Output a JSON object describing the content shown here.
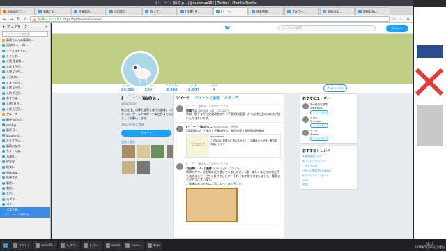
{
  "window": {
    "title": "(・｀ー´・)ぬのぉ…(@nunonuo15) | Twitter - Mozilla Firefox"
  },
  "tabs": [
    {
      "label": "Blogger: こ…",
      "type": "blogger"
    },
    {
      "label": "長崎にゃ…",
      "type": "twitter"
    },
    {
      "label": "佐賀県の…",
      "type": "twitter"
    },
    {
      "label": "山口県で…",
      "type": "twitter"
    },
    {
      "label": "(伝えて…",
      "type": "twitter"
    },
    {
      "label": "(自撮りを…",
      "type": "twitter"
    },
    {
      "label": "(・｀ー…",
      "type": "twitter",
      "active": true
    },
    {
      "label": "囲碁戦略…",
      "type": "twitter"
    },
    {
      "label": "フォロー…",
      "type": "twitter"
    },
    {
      "label": "WebLOG…",
      "type": "other"
    },
    {
      "label": "WebLOG…",
      "type": "other"
    }
  ],
  "navbar": {
    "url_org": "Twitter, Inc. (US)",
    "url": "https://twitter.com/nunonuo"
  },
  "sidebar": {
    "title": "ブックマーク",
    "search_placeholder": "ブックマークを検索",
    "items": [
      {
        "label": "藤崎ちゃんの藤崎の…",
        "type": "folder"
      },
      {
        "label": "速報(ニュース)…",
        "type": "tw"
      },
      {
        "label": "ノースライトの…",
        "type": "tw"
      },
      {
        "label": "こうたの…",
        "type": "tw"
      },
      {
        "label": "入院 患者数…",
        "type": "tw"
      },
      {
        "label": "入院 1日目…",
        "type": "tw"
      },
      {
        "label": "入院 2日目…",
        "type": "tw"
      },
      {
        "label": "十日町の…",
        "type": "tw"
      },
      {
        "label": "くまちゃん…",
        "type": "tw"
      },
      {
        "label": "入院 3日目…",
        "type": "tw"
      },
      {
        "label": "入院 4日目…",
        "type": "tw"
      },
      {
        "label": "おきつ@…",
        "type": "tw"
      },
      {
        "label": "入院4日目…",
        "type": "tw"
      },
      {
        "label": "入院 5日目…",
        "type": "tw"
      },
      {
        "label": "グループ",
        "type": "folder"
      },
      {
        "label": "藤巻 @fnm…",
        "type": "tw"
      },
      {
        "label": "mm8@…",
        "type": "tw"
      },
      {
        "label": "藤原-3.…",
        "type": "tw"
      },
      {
        "label": "kazufumi…",
        "type": "tw"
      },
      {
        "label": "ダイクプレ…",
        "type": "tw"
      },
      {
        "label": "藤崎のなぎ…",
        "type": "tw"
      },
      {
        "label": "ちりーん@…",
        "type": "tw"
      },
      {
        "label": "TORU…",
        "type": "tw"
      },
      {
        "label": "鈴谷@…",
        "type": "tw"
      },
      {
        "label": "結束(…",
        "type": "tw"
      },
      {
        "label": "Shibata…",
        "type": "tw"
      },
      {
        "label": "佐藤さま…",
        "type": "tw"
      },
      {
        "label": "藤原…",
        "type": "tw"
      },
      {
        "label": "兼松…",
        "type": "tw"
      },
      {
        "label": "大戸…",
        "type": "tw"
      },
      {
        "label": "コダマ…",
        "type": "tw"
      },
      {
        "label": "ゴリ…",
        "type": "tw"
      },
      {
        "label": "ゴスペ@…",
        "type": "tw",
        "selected": true
      },
      {
        "label": "(・｀ー´・)ぬのぉ…",
        "type": "tw",
        "selected": true
      }
    ]
  },
  "twitter": {
    "search_placeholder": "キーワード検索",
    "tweet_button": "ツイート",
    "stats": [
      {
        "label": "ツイート",
        "value": "24,586"
      },
      {
        "label": "フォロー",
        "value": "234"
      },
      {
        "label": "フォロワー",
        "value": "2,608"
      },
      {
        "label": "いいね",
        "value": "2,007"
      },
      {
        "label": "リスト",
        "value": "4"
      }
    ],
    "follow_button": "フォローする",
    "profile": {
      "name": "(・｀ー´・)ぬのぉ…",
      "handle": "@nunonuo",
      "bio": "地方在住。法律と温泉と旅行が趣味。つぶやきは個人的なもの。ゲームやスポーツなど色々とつぶやきます。よろしくお願いします。",
      "joined": "2012年9月に登録",
      "tweet_button": "ツイート",
      "media_label": "画像と動画"
    },
    "timeline_tabs": [
      "ツイート",
      "ツイートと返信",
      "メディア"
    ],
    "tweets": [
      {
        "context": "(・｀ー´・)ぬのぉ…さんがリツイート",
        "author": "将棋ペン",
        "handle": "@shogi_pen · 5月22日",
        "text": "将棋、勝手ながら文書改善の件（不変将棋連盟）から自棋士会の本をお付けいただきたいです。"
      },
      {
        "context": "",
        "author": "(・｀ー´・)ぬのぉ…",
        "handle": "@nunonuo · 9時間",
        "text": "2個200の人・「本日」手書き持ち、各回送迎大雨時数同時開催",
        "card_title": "mochibado",
        "card_text": "この届けにお得いに来れるかな？ この報はいつが良と魅力をお届けします",
        "card_logo": "ココログ"
      },
      {
        "context": "(・｀ー´・)ぬのぉ…さんがリツイート",
        "author": "羽田森(・ノ・) 夏休",
        "handle": "@anonym · 5月23日",
        "text": "将棋の中で、初主戦の近う違いでいましたが、1番一度もくまにでの位に手を進めまして、ごちゃ負けでしたが、それそれで棋で参加しました。解説ありがとうございます。",
        "extra": "ご興味のあるお方はご覧になってみて下さい"
      }
    ],
    "who_to_follow": {
      "title": "おすすめユーザー",
      "users": [
        {
          "name": "清水純持与猫門",
          "handle": "@shimizu..."
        },
        {
          "name": "ミカキ",
          "handle": "@mikaki..."
        },
        {
          "name": "サイボ",
          "handle": "@saibo..."
        }
      ],
      "follow_label": "フォローする"
    },
    "trends": {
      "title": "おすすめトレンド",
      "items": [
        {
          "tag": "#雑談語る日本人",
          "count": ""
        },
        {
          "tag": "#ソフトバンクロック",
          "count": ""
        },
        {
          "tag": "二代方の言語",
          "count": ""
        },
        {
          "tag": "バザン公開放送@GAMAX",
          "count": ""
        },
        {
          "tag": "#ファミリーエスピード",
          "count": ""
        },
        {
          "tag": "2DIO",
          "count": ""
        },
        {
          "tag": "天皇",
          "count": ""
        }
      ]
    }
  },
  "taskbar": {
    "items": [
      "マウント",
      "eman25…",
      "α_スク…",
      "ヒカン…",
      "sclock",
      "wywe…",
      "dogo"
    ],
    "time": "21:12",
    "date": "2018年5月28日 月曜日"
  },
  "colors": {
    "accent": "#1da1f2",
    "header": "#c1cf85"
  }
}
